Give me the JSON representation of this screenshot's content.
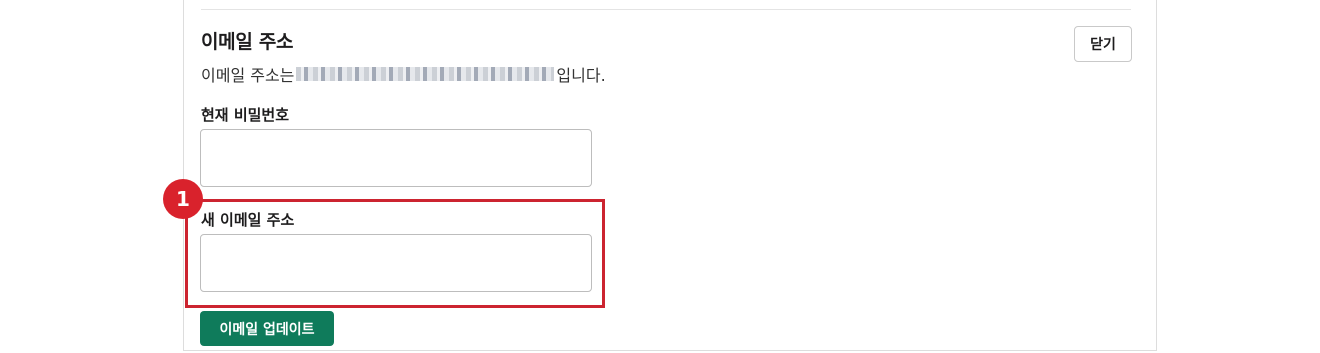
{
  "section": {
    "title": "이메일 주소",
    "description_prefix": "이메일 주소는 ",
    "description_suffix": "입니다.",
    "close_label": "닫기"
  },
  "form": {
    "current_password_label": "현재 비밀번호",
    "current_password_value": "",
    "new_email_label": "새 이메일 주소",
    "new_email_value": "",
    "submit_label": "이메일 업데이트"
  },
  "annotation": {
    "step_number": "1",
    "color": "#cc2430"
  },
  "colors": {
    "primary_button": "#0f7b5b"
  }
}
